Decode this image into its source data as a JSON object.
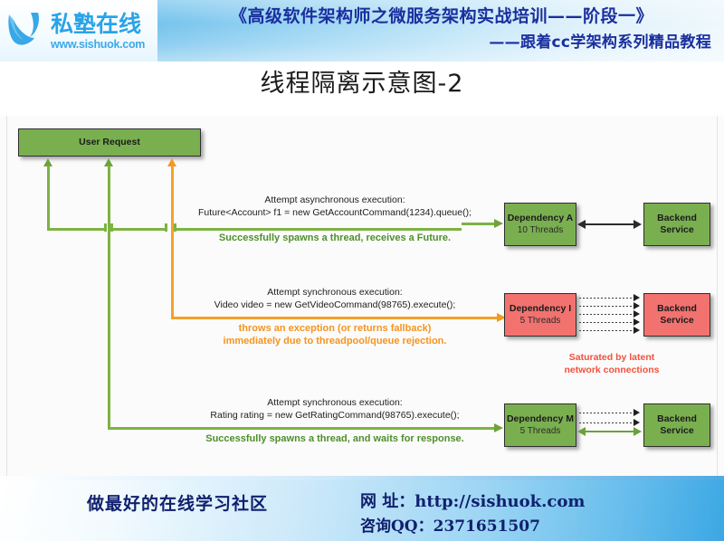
{
  "header": {
    "logo_cn": "私塾在线",
    "logo_url": "www.sishuok.com",
    "logo_icon": "bird-swoosh-logo-icon",
    "title": "《高级软件架构师之微服务架构实战培训——阶段一》",
    "subtitle": "——跟着cc学架构系列精品教程"
  },
  "page": {
    "title": "线程隔离示意图-2"
  },
  "diagram": {
    "user_request": "User Request",
    "rows": [
      {
        "attempt": "Attempt asynchronous execution:",
        "code": "Future<Account> f1 = new GetAccountCommand(1234).queue();",
        "result": "Successfully spawns a thread, receives a Future.",
        "result_color": "#4e8f2a",
        "dependency_name": "Dependency A",
        "dependency_threads": "10 Threads",
        "dependency_color": "#7aaf50",
        "backend_name_line1": "Backend",
        "backend_name_line2": "Service",
        "backend_color": "#7aaf50",
        "connector": "double-headed-solid-arrow"
      },
      {
        "attempt": "Attempt synchronous execution:",
        "code": "Video video = new GetVideoCommand(98765).execute();",
        "result_line1": "throws an exception (or returns fallback)",
        "result_line2": "immediately due to threadpool/queue rejection.",
        "result_color": "#f59420",
        "dependency_name": "Dependency I",
        "dependency_threads": "5 Threads",
        "dependency_color": "#f2726f",
        "backend_name_line1": "Backend",
        "backend_name_line2": "Service",
        "backend_color": "#f2726f",
        "connector": "five-dotted-arrows",
        "note_line1": "Saturated by latent",
        "note_line2": "network connections",
        "note_color": "#f4503c"
      },
      {
        "attempt": "Attempt synchronous execution:",
        "code": "Rating rating = new GetRatingCommand(98765).execute();",
        "result": "Successfully spawns a thread, and waits for response.",
        "result_color": "#4e8f2a",
        "dependency_name": "Dependency M",
        "dependency_threads": "5 Threads",
        "dependency_color": "#7aaf50",
        "backend_name_line1": "Backend",
        "backend_name_line2": "Service",
        "backend_color": "#7aaf50",
        "connector": "two-dotted-arrows-and-green-double-arrow"
      }
    ],
    "colors": {
      "green_line": "#7cb342",
      "orange_line": "#f6a02a",
      "green_box": "#7aaf50",
      "red_box": "#f2726f"
    }
  },
  "footer": {
    "slogan": "做最好的在线学习社区",
    "url": "网  址：http://sishuok.com",
    "qq": "咨询QQ：2371651507"
  }
}
